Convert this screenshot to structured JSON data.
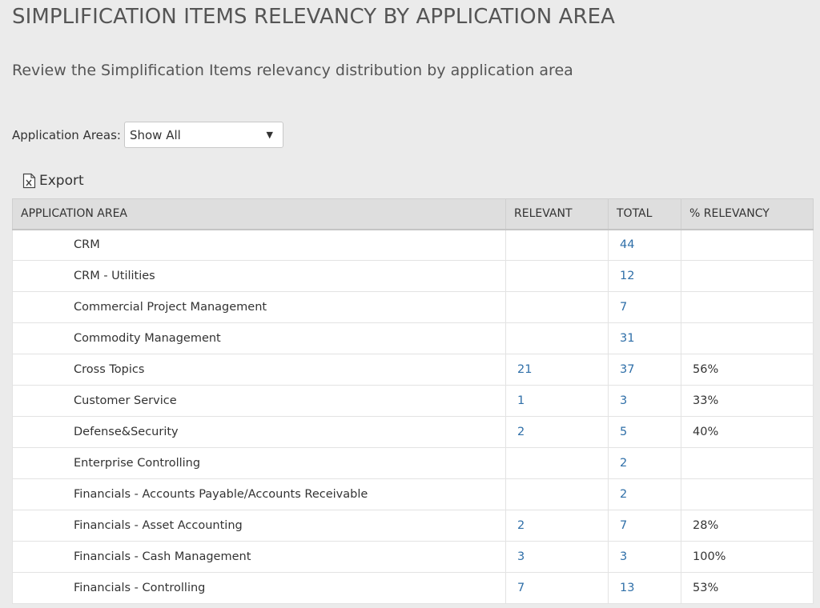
{
  "page": {
    "title": "SIMPLIFICATION ITEMS RELEVANCY BY APPLICATION AREA",
    "subtitle": "Review the Simplification Items relevancy distribution by application area"
  },
  "filter": {
    "label": "Application Areas:",
    "selected": "Show All",
    "arrow_icon": "triangle-down-icon"
  },
  "export": {
    "label": "Export",
    "icon": "excel-file-icon"
  },
  "table": {
    "columns": [
      "APPLICATION AREA",
      "RELEVANT",
      "TOTAL",
      "% RELEVANCY"
    ],
    "rows": [
      {
        "area": "CRM",
        "relevant": "",
        "total": "44",
        "pct": ""
      },
      {
        "area": "CRM - Utilities",
        "relevant": "",
        "total": "12",
        "pct": ""
      },
      {
        "area": "Commercial Project Management",
        "relevant": "",
        "total": "7",
        "pct": ""
      },
      {
        "area": "Commodity Management",
        "relevant": "",
        "total": "31",
        "pct": ""
      },
      {
        "area": "Cross Topics",
        "relevant": "21",
        "total": "37",
        "pct": "56%"
      },
      {
        "area": "Customer Service",
        "relevant": "1",
        "total": "3",
        "pct": "33%"
      },
      {
        "area": "Defense&Security",
        "relevant": "2",
        "total": "5",
        "pct": "40%"
      },
      {
        "area": "Enterprise Controlling",
        "relevant": "",
        "total": "2",
        "pct": ""
      },
      {
        "area": "Financials - Accounts Payable/Accounts Receivable",
        "relevant": "",
        "total": "2",
        "pct": ""
      },
      {
        "area": "Financials - Asset Accounting",
        "relevant": "2",
        "total": "7",
        "pct": "28%"
      },
      {
        "area": "Financials - Cash Management",
        "relevant": "3",
        "total": "3",
        "pct": "100%"
      },
      {
        "area": "Financials - Controlling",
        "relevant": "7",
        "total": "13",
        "pct": "53%"
      }
    ]
  },
  "colors": {
    "background": "#ebebeb",
    "link": "#2f6fa8",
    "header_bg": "#dedede"
  }
}
